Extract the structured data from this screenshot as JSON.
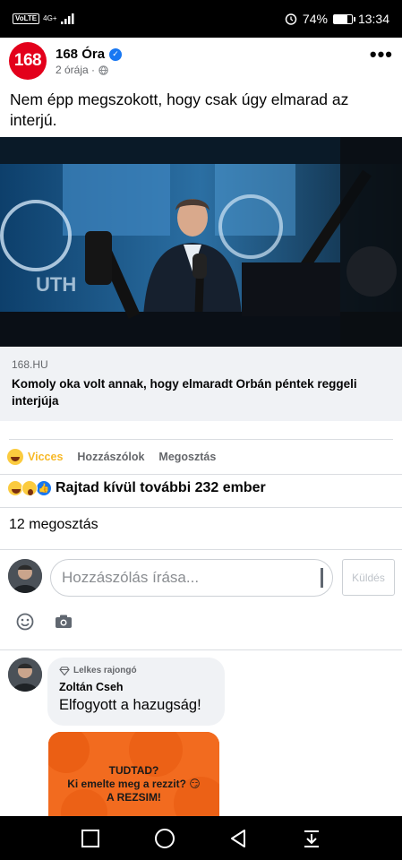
{
  "status_bar": {
    "volte": "VoLTE",
    "network": "4G+",
    "battery": "74%",
    "battery_level": 0.74,
    "time": "13:34"
  },
  "post": {
    "page_logo_text": "168",
    "page_name": "168 Óra",
    "time_ago": "2 órája ·",
    "text": "Nem épp megszokott, hogy csak úgy elmarad az interjú."
  },
  "link_preview": {
    "domain": "168.HU",
    "title": "Komoly oka volt annak, hogy elmaradt Orbán péntek reggeli interjúja"
  },
  "actions": {
    "reaction_label": "Vicces",
    "comment_label": "Hozzászólok",
    "share_label": "Megosztás"
  },
  "reactions": {
    "summary": "Rajtad kívül további 232 ember"
  },
  "shares": {
    "text": "12 megosztás"
  },
  "comment_input": {
    "placeholder": "Hozzászólás írása...",
    "send_label": "Küldés"
  },
  "comment": {
    "badge": "Lelkes rajongó",
    "author": "Zoltán Cseh",
    "text": "Elfogyott a hazugság!",
    "image_line1": "TUDTAD?",
    "image_line2": "Ki emelte meg a rezzit? 😏",
    "image_line3": "A REZSIM!"
  },
  "colors": {
    "brand_red": "#e3001b",
    "facebook_blue": "#1877f2",
    "haha_yellow": "#f7b928"
  }
}
